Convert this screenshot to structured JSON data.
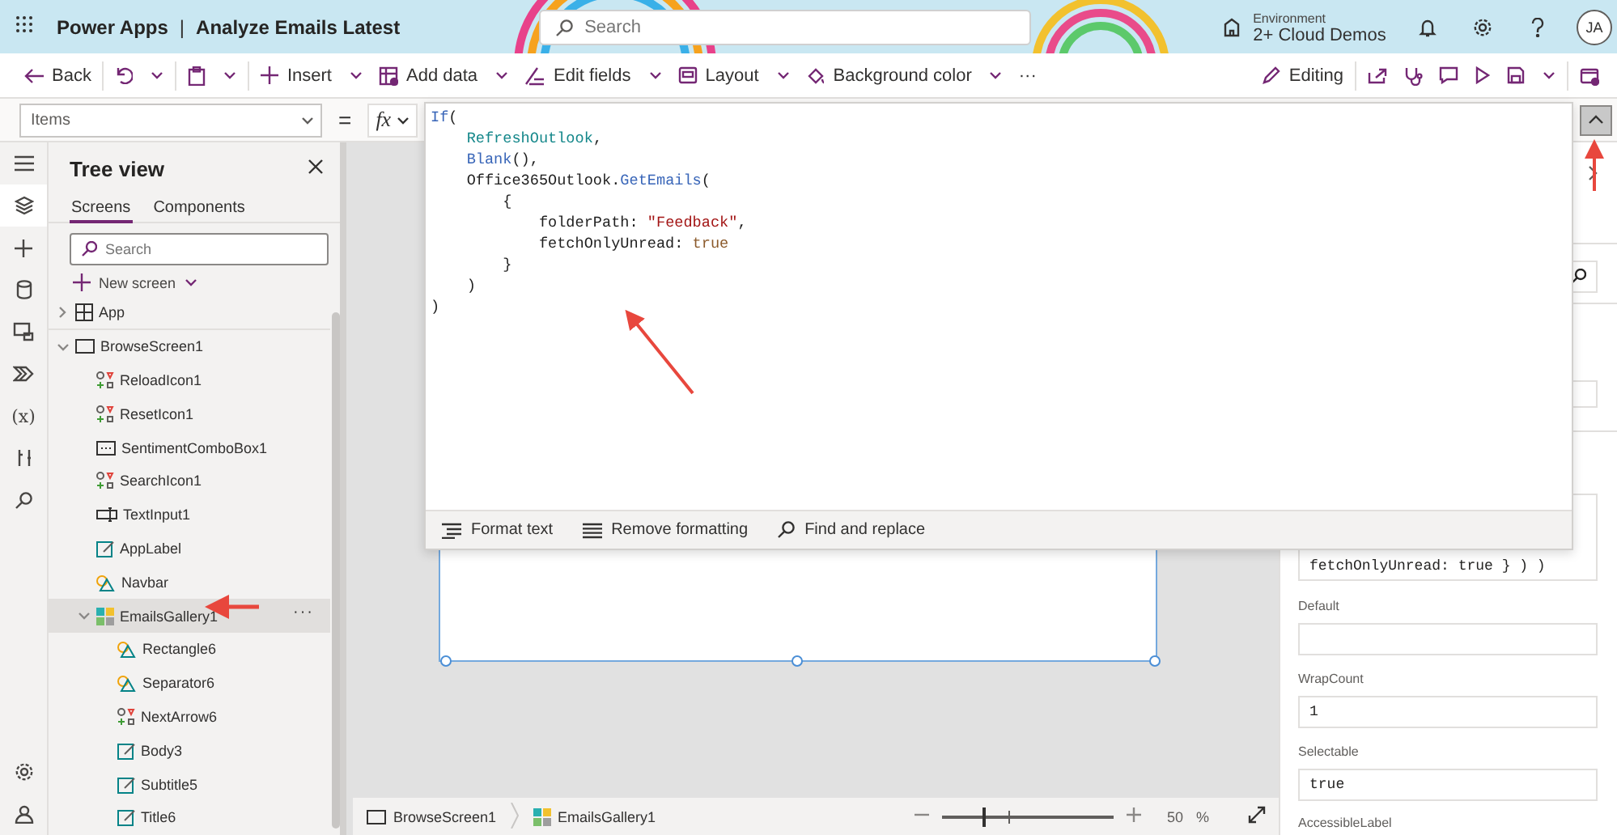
{
  "header": {
    "app_name": "Power Apps",
    "separator": "|",
    "app_title": "Analyze Emails Latest",
    "search": {
      "placeholder": "Search"
    },
    "environment": {
      "label": "Environment",
      "name": "2+ Cloud Demos"
    },
    "avatar": "JA"
  },
  "toolbar": {
    "left": [
      {
        "label": "Back",
        "menu": false
      },
      {
        "menu": true
      },
      {
        "menu": true
      },
      {
        "label": "Insert",
        "menu": true
      },
      {
        "label": "Add data",
        "menu": true
      },
      {
        "label": "Edit fields",
        "menu": true
      },
      {
        "label": "Layout",
        "menu": true
      },
      {
        "label": "Background color",
        "menu": true
      },
      {
        "label": "···",
        "menu": false
      }
    ],
    "right": [
      {
        "label": "Editing",
        "menu": false
      },
      {
        "menu": false
      },
      {
        "menu": false
      },
      {
        "menu": false
      },
      {
        "menu": false
      },
      {
        "menu": true
      },
      {
        "menu": false
      }
    ]
  },
  "formula_bar": {
    "property": "Items",
    "equals": "=",
    "fx": "fx"
  },
  "formula_editor": {
    "lines": [
      [
        {
          "text": "If",
          "kind": "function"
        },
        {
          "text": "(",
          "kind": "plain"
        }
      ],
      [
        {
          "text": "    RefreshOutlook",
          "kind": "variable"
        },
        {
          "text": ",",
          "kind": "plain"
        }
      ],
      [
        {
          "text": "    Blank",
          "kind": "function"
        },
        {
          "text": "(),",
          "kind": "plain"
        }
      ],
      [
        {
          "text": "    Office365Outlook.",
          "kind": "plain"
        },
        {
          "text": "GetEmails",
          "kind": "function"
        },
        {
          "text": "(",
          "kind": "plain"
        }
      ],
      [
        {
          "text": "        {",
          "kind": "plain"
        }
      ],
      [
        {
          "text": "            folderPath: ",
          "kind": "plain"
        },
        {
          "text": "\"Feedback\"",
          "kind": "string"
        },
        {
          "text": ",",
          "kind": "plain"
        }
      ],
      [
        {
          "text": "            fetchOnlyUnread: ",
          "kind": "plain"
        },
        {
          "text": "true",
          "kind": "boolean"
        }
      ],
      [
        {
          "text": "        }",
          "kind": "plain"
        }
      ],
      [
        {
          "text": "    )",
          "kind": "plain"
        }
      ],
      [
        {
          "text": ")",
          "kind": "plain"
        }
      ]
    ],
    "tools": [
      "Format text",
      "Remove formatting",
      "Find and replace"
    ]
  },
  "rail": {
    "top": [
      {
        "selected": false
      },
      {
        "selected": true
      },
      {
        "selected": false
      },
      {
        "selected": false
      },
      {
        "selected": false
      },
      {
        "selected": false
      },
      {
        "label": "(x)",
        "selected": false
      },
      {
        "selected": false
      },
      {
        "selected": false
      }
    ],
    "bottom": [
      {
        "selected": false
      },
      {
        "selected": false
      }
    ]
  },
  "tree_view": {
    "title": "Tree view",
    "tabs": [
      {
        "label": "Screens",
        "selected": true
      },
      {
        "label": "Components",
        "selected": false
      }
    ],
    "search": {
      "placeholder": "Search"
    },
    "new_screen": "New screen",
    "items": [
      {
        "label": "App",
        "kind": "app",
        "expanded": false,
        "selected": false
      },
      {
        "label": "BrowseScreen1",
        "kind": "screen",
        "expanded": true,
        "selected": false,
        "children": [
          {
            "label": "ReloadIcon1",
            "kind": "icon",
            "selected": false
          },
          {
            "label": "ResetIcon1",
            "kind": "icon",
            "selected": false
          },
          {
            "label": "SentimentComboBox1",
            "kind": "combobox",
            "selected": false
          },
          {
            "label": "SearchIcon1",
            "kind": "icon",
            "selected": false
          },
          {
            "label": "TextInput1",
            "kind": "textinput",
            "selected": false
          },
          {
            "label": "AppLabel",
            "kind": "label",
            "selected": false
          },
          {
            "label": "Navbar",
            "kind": "shape",
            "selected": false
          },
          {
            "label": "EmailsGallery1",
            "kind": "gallery",
            "expanded": true,
            "selected": true,
            "actions": "···",
            "children": [
              {
                "label": "Rectangle6",
                "kind": "shape",
                "selected": false
              },
              {
                "label": "Separator6",
                "kind": "shape",
                "selected": false
              },
              {
                "label": "NextArrow6",
                "kind": "icon",
                "selected": false
              },
              {
                "label": "Body3",
                "kind": "label",
                "selected": false
              },
              {
                "label": "Subtitle5",
                "kind": "label",
                "selected": false
              },
              {
                "label": "Title6",
                "kind": "label",
                "selected": false
              }
            ]
          }
        ]
      }
    ]
  },
  "status_bar": {
    "breadcrumb": [
      {
        "label": "BrowseScreen1",
        "kind": "screen"
      },
      {
        "label": "EmailsGallery1",
        "kind": "gallery"
      }
    ],
    "zoom": {
      "level": 0.24,
      "reading": "50",
      "unit": "%"
    }
  },
  "properties": {
    "formula_value": "fetchOnlyUnread: true } ) )",
    "fields": [
      {
        "label": "Default"
      },
      {
        "label": "WrapCount",
        "value": "1"
      },
      {
        "label": "Selectable",
        "value": "true"
      }
    ],
    "next_label": "AccessibleLabel"
  }
}
